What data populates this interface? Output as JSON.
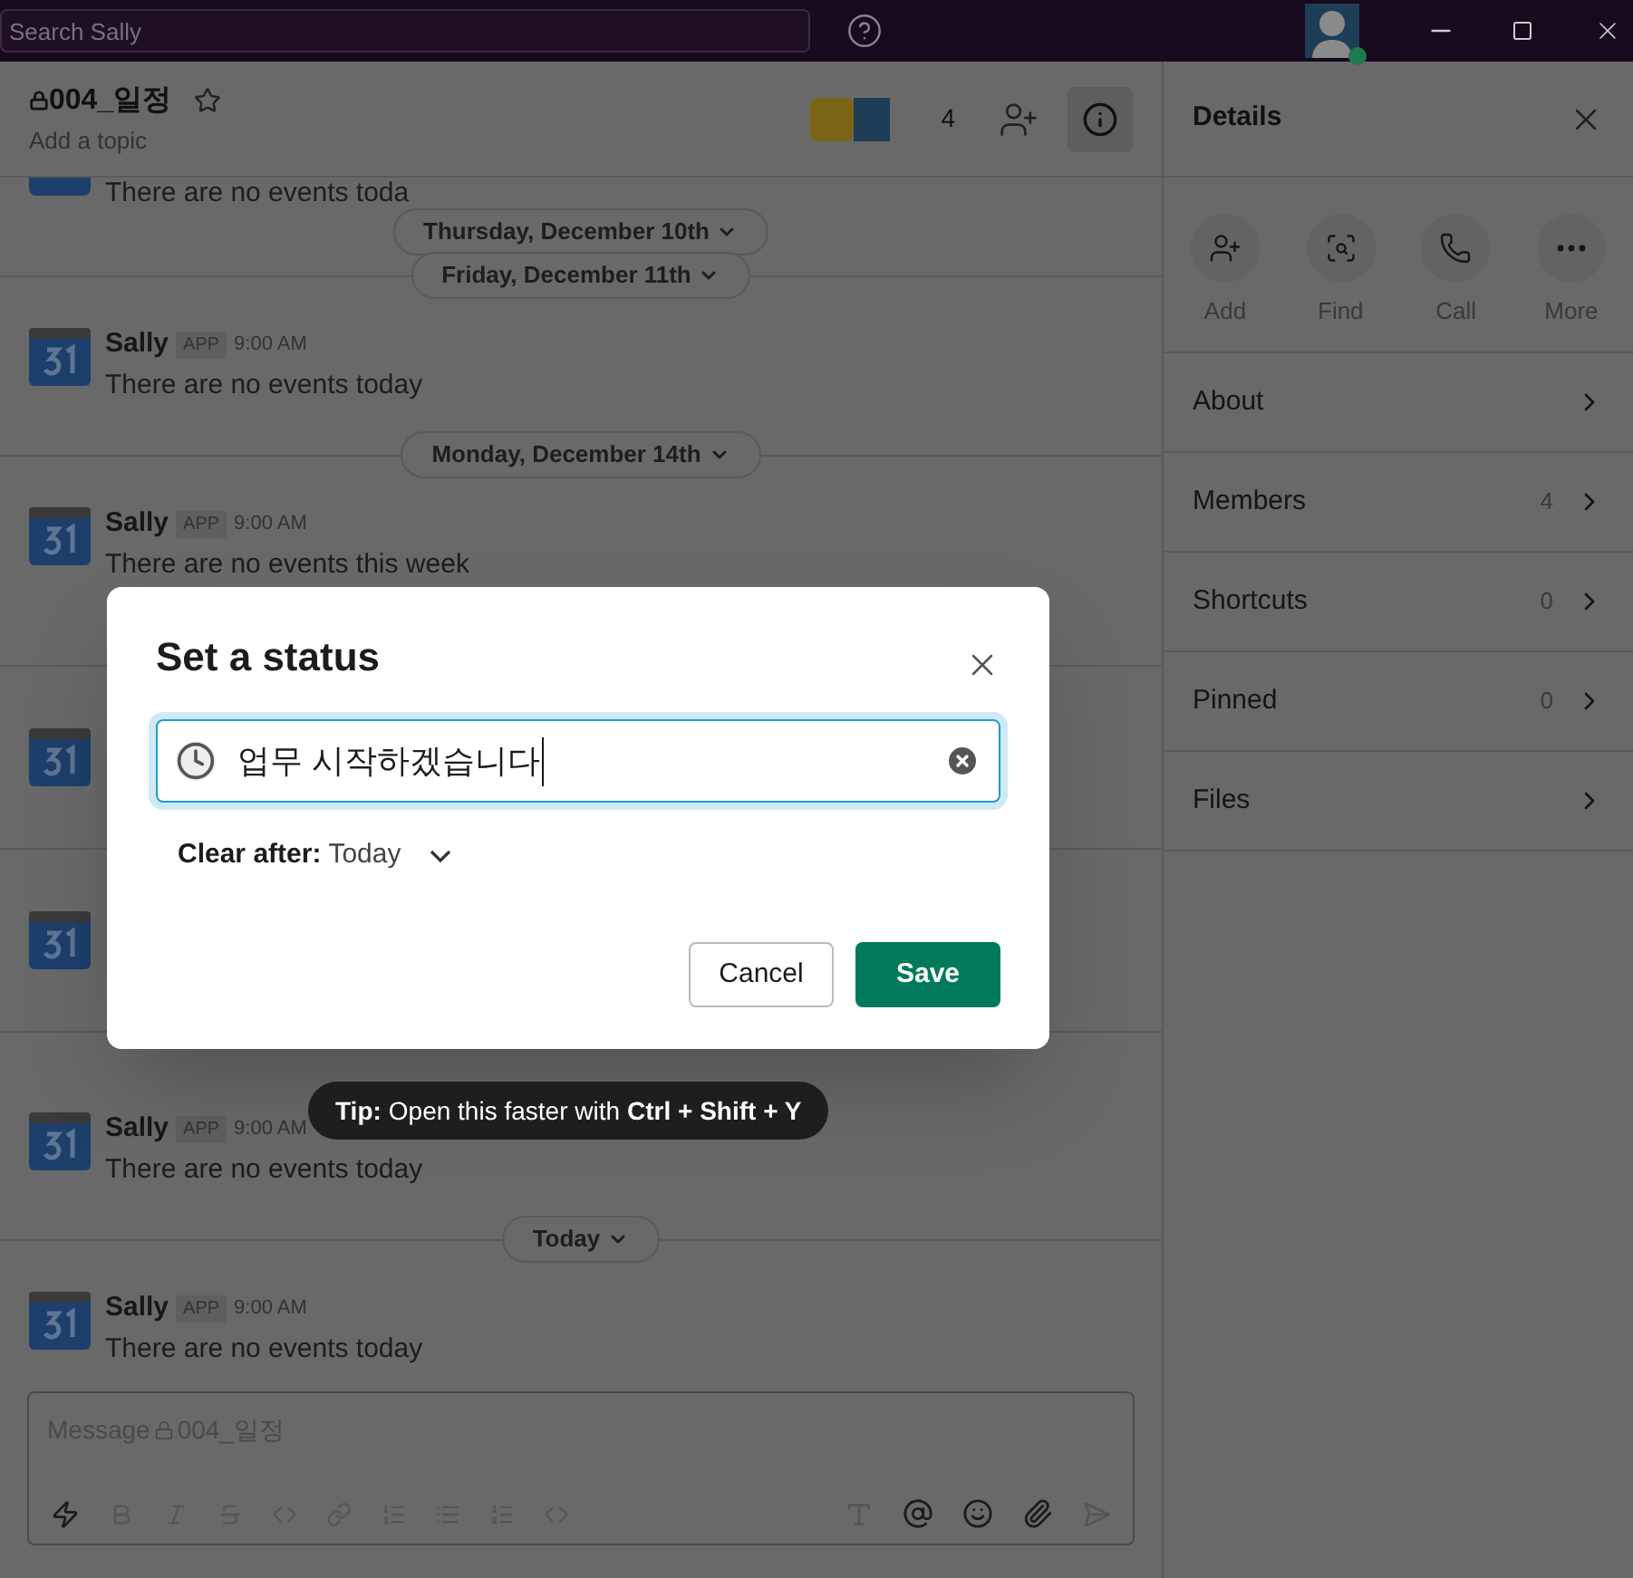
{
  "titlebar": {
    "search_placeholder": "Search Sally"
  },
  "channel": {
    "name": "004_일정",
    "topic": "Add a topic",
    "member_count": "4"
  },
  "messages": [
    {
      "kind": "partial_text",
      "text": "There are no events toda"
    },
    {
      "kind": "sticky_date",
      "label": "Thursday, December 10th"
    },
    {
      "kind": "date",
      "label": "Friday, December 11th"
    },
    {
      "kind": "message",
      "author": "Sally",
      "badge": "APP",
      "time": "9:00 AM",
      "text": "There are no events today"
    },
    {
      "kind": "date",
      "label": "Monday, December 14th"
    },
    {
      "kind": "message",
      "author": "Sally",
      "badge": "APP",
      "time": "9:00 AM",
      "text": "There are no events this week"
    },
    {
      "kind": "rule"
    },
    {
      "kind": "avatar_only"
    },
    {
      "kind": "rule"
    },
    {
      "kind": "avatar_only"
    },
    {
      "kind": "rule"
    },
    {
      "kind": "message",
      "author": "Sally",
      "badge": "APP",
      "time": "9:00 AM",
      "text": "There are no events today"
    },
    {
      "kind": "date",
      "label": "Today"
    },
    {
      "kind": "message",
      "author": "Sally",
      "badge": "APP",
      "time": "9:00 AM",
      "text": "There are no events today"
    }
  ],
  "composer": {
    "placeholder": "Message ",
    "channel": "004_일정"
  },
  "details": {
    "title": "Details",
    "actions": [
      {
        "kind": "add",
        "label": "Add"
      },
      {
        "kind": "find",
        "label": "Find"
      },
      {
        "kind": "call",
        "label": "Call"
      },
      {
        "kind": "more",
        "label": "More"
      }
    ],
    "sections": [
      {
        "label": "About"
      },
      {
        "label": "Members",
        "count": "4"
      },
      {
        "label": "Shortcuts",
        "count": "0"
      },
      {
        "label": "Pinned",
        "count": "0"
      },
      {
        "label": "Files"
      }
    ]
  },
  "dialog": {
    "title": "Set a status",
    "value": "업무 시작하겠습니다",
    "clear_label": "Clear after:",
    "clear_value": "Today",
    "cancel": "Cancel",
    "save": "Save"
  },
  "tip": {
    "label": "Tip:",
    "text": "Open this faster with",
    "keys": "Ctrl + Shift + Y"
  }
}
